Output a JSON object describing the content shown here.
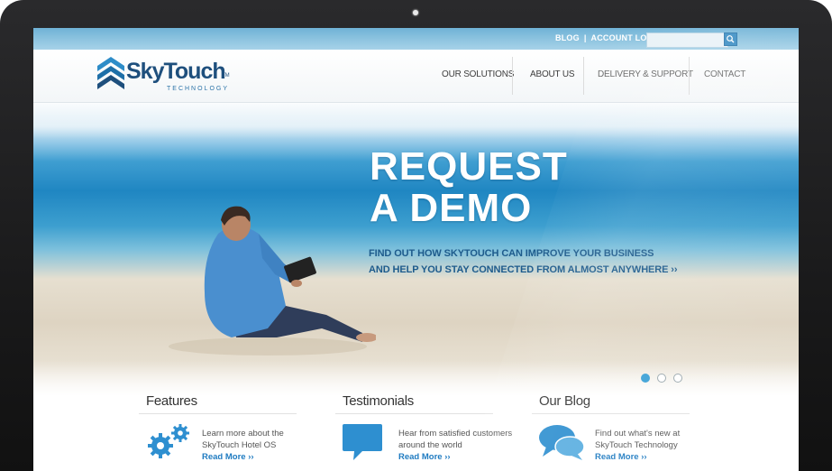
{
  "topbar": {
    "blog": "BLOG",
    "separator": "|",
    "account_login": "ACCOUNT LOGIN",
    "search_placeholder": ""
  },
  "logo": {
    "name": "SkyTouch",
    "tm": "TM",
    "tagline": "TECHNOLOGY"
  },
  "nav": {
    "items": [
      "OUR SOLUTIONS",
      "ABOUT US",
      "DELIVERY & SUPPORT",
      "CONTACT"
    ]
  },
  "hero": {
    "title_line1": "REQUEST",
    "title_line2": "A DEMO",
    "sub_line1": "FIND OUT HOW SKYTOUCH CAN IMPROVE YOUR BUSINESS",
    "sub_line2": "AND HELP YOU STAY CONNECTED FROM ALMOST ANYWHERE ››",
    "slides_total": 3,
    "slide_active": 1
  },
  "columns": [
    {
      "title": "Features",
      "icon": "gears-icon",
      "text": "Learn more about the SkyTouch Hotel OS",
      "link": "Read More ››"
    },
    {
      "title": "Testimonials",
      "icon": "speech-bubble-icon",
      "text": "Hear from satisfied customers around the world",
      "link": "Read More ››"
    },
    {
      "title": "Our Blog",
      "icon": "chat-bubbles-icon",
      "text": "Find out what's new at SkyTouch Technology",
      "link": "Read More ››"
    }
  ],
  "colors": {
    "brand": "#1e4f7d",
    "accent": "#1f7bc1",
    "icon_blue": "#2e8fd0"
  }
}
